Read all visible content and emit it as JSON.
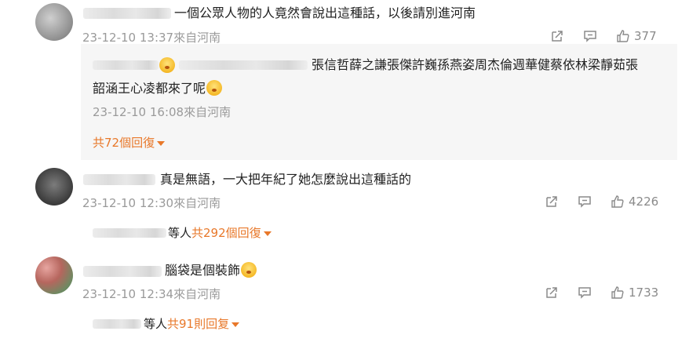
{
  "comments": [
    {
      "text": "一個公眾人物的人竟然會說出這種話，以後請別進河南",
      "time": "23-12-10 13:37來自河南",
      "likes": "377",
      "reply": {
        "text_line1": "張信哲薛之謙張傑許巍孫燕姿周杰倫週華健蔡依林梁靜茹張",
        "text_line2": "韶涵王心凌都來了呢",
        "time": "23-12-10 16:08來自河南",
        "more": "共72個回復"
      }
    },
    {
      "text": "真是無語，一大把年紀了她怎麼說出這種話的",
      "time": "23-12-10 12:30來自河南",
      "likes": "4226",
      "replies_who": "等人",
      "replies_more": "共292個回復"
    },
    {
      "text": "腦袋是個裝飾",
      "time": "23-12-10 12:34來自河南",
      "likes": "1733",
      "replies_who": "等人",
      "replies_more": "共91則回复"
    }
  ],
  "icons": {
    "share": "share-icon",
    "comment": "comment-icon",
    "like": "like-icon",
    "emoji": "emoji-icon"
  }
}
